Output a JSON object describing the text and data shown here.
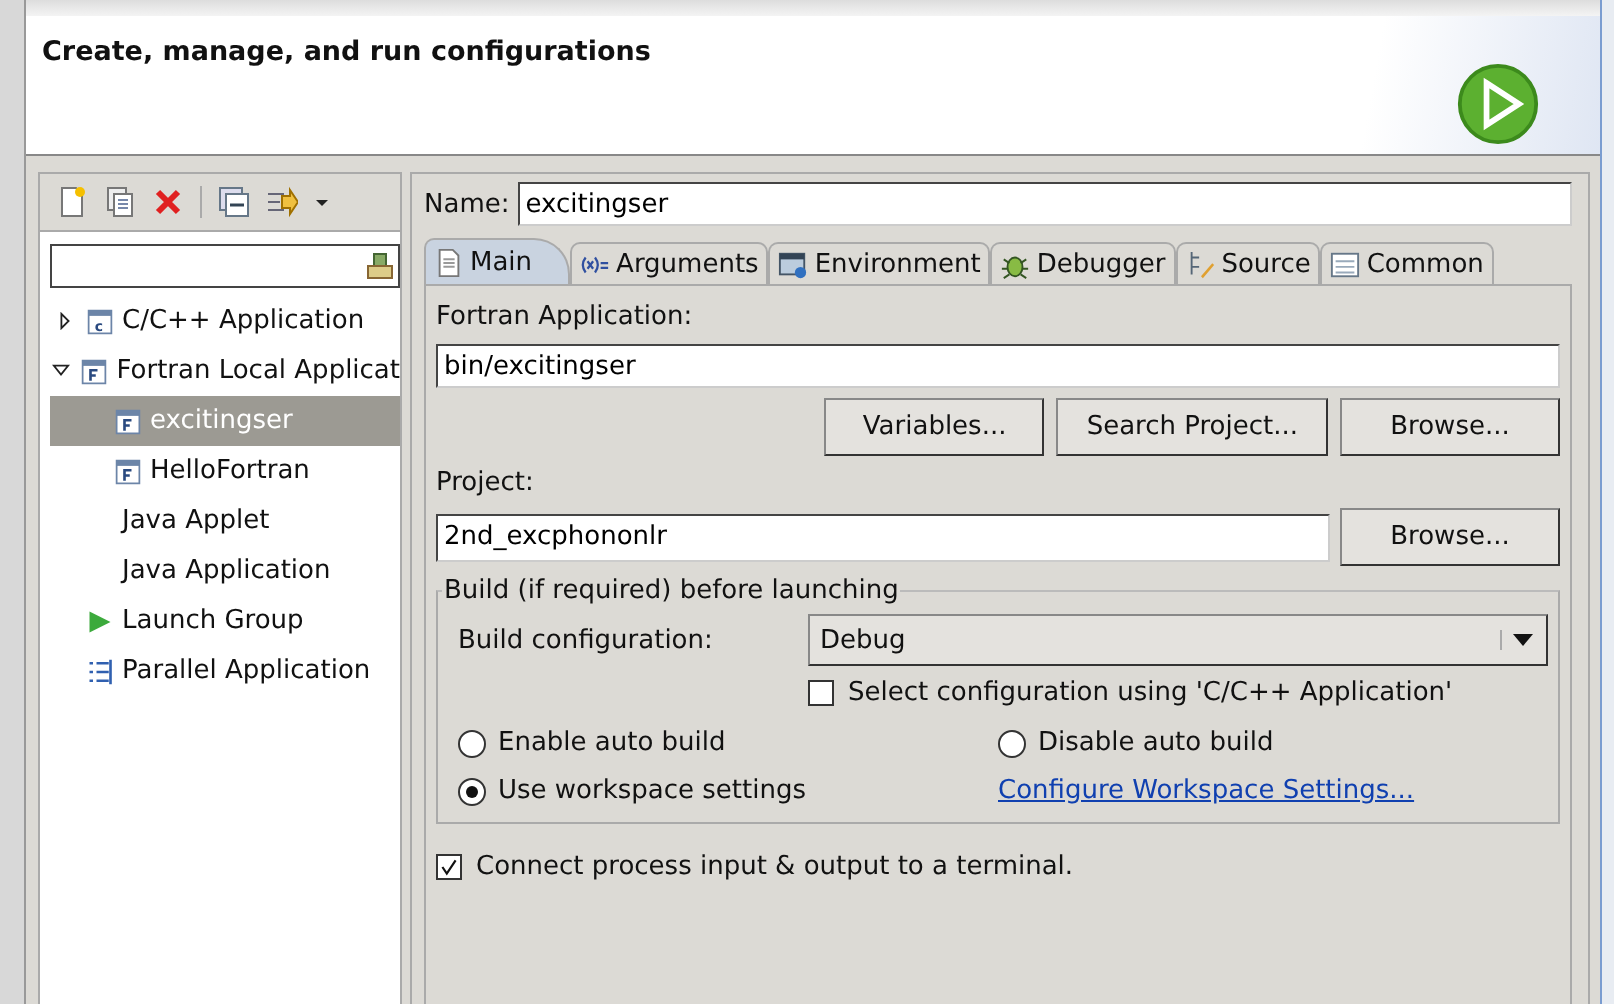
{
  "header": {
    "title": "Create, manage, and run configurations"
  },
  "tree": {
    "items": [
      {
        "label": "C/C++ Application",
        "kind": "c",
        "expanded": false,
        "selected": false
      },
      {
        "label": "Fortran Local Applicat",
        "kind": "fortran",
        "expanded": true,
        "selected": false,
        "children": [
          {
            "label": "excitingser",
            "kind": "fortran",
            "selected": true
          },
          {
            "label": "HelloFortran",
            "kind": "fortran",
            "selected": false
          }
        ]
      },
      {
        "label": "Java Applet",
        "kind": "plain",
        "selected": false
      },
      {
        "label": "Java Application",
        "kind": "plain",
        "selected": false
      },
      {
        "label": "Launch Group",
        "kind": "launch",
        "selected": false
      },
      {
        "label": "Parallel Application",
        "kind": "parallel",
        "selected": false
      }
    ]
  },
  "name": {
    "label": "Name:",
    "value": "excitingser"
  },
  "tabs": [
    {
      "label": "Main",
      "kind": "main",
      "selected": true
    },
    {
      "label": "Arguments",
      "kind": "arguments",
      "selected": false
    },
    {
      "label": "Environment",
      "kind": "environment",
      "selected": false
    },
    {
      "label": "Debugger",
      "kind": "debugger",
      "selected": false
    },
    {
      "label": "Source",
      "kind": "source",
      "selected": false
    },
    {
      "label": "Common",
      "kind": "common",
      "selected": false
    }
  ],
  "main": {
    "application_label": "Fortran Application:",
    "application_value": "bin/excitingser",
    "application_buttons": [
      "Variables...",
      "Search Project...",
      "Browse..."
    ],
    "project_label": "Project:",
    "project_value": "2nd_excphononlr",
    "project_button": "Browse...",
    "build": {
      "title": "Build (if required) before launching",
      "config_label": "Build configuration:",
      "config_value": "Debug",
      "select_config": {
        "label": "Select configuration using 'C/C++ Application'",
        "checked": false
      },
      "radios": [
        {
          "label": "Enable auto build",
          "selected": false
        },
        {
          "label": "Disable auto build",
          "selected": false
        },
        {
          "label": "Use workspace settings",
          "selected": true
        }
      ],
      "link": "Configure Workspace Settings..."
    },
    "terminal": {
      "label": "Connect process input & output to a terminal.",
      "checked": true
    }
  }
}
